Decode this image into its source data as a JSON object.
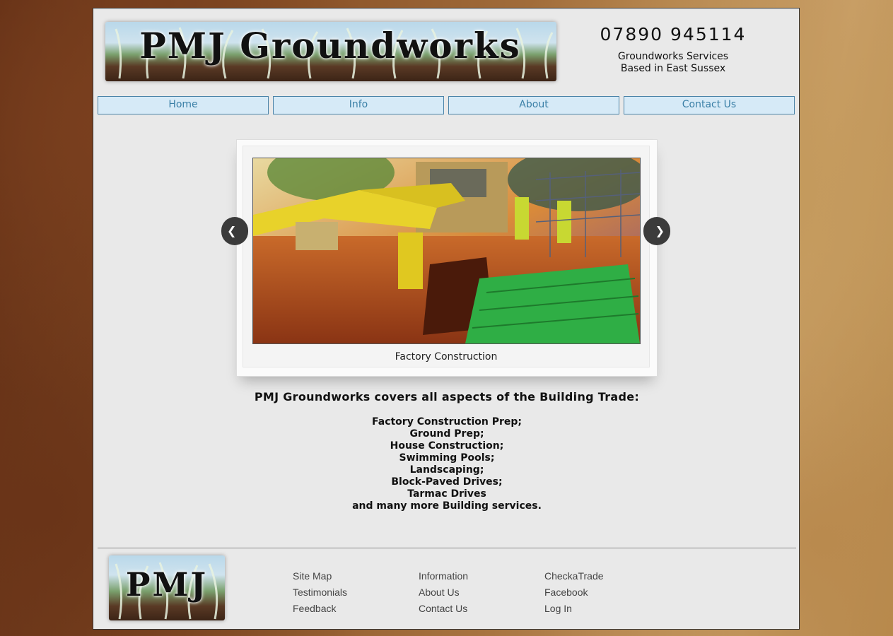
{
  "header": {
    "logo_text": "PMJ Groundworks",
    "phone": "07890 945114",
    "tagline_line1": "Groundworks Services",
    "tagline_line2": "Based in East Sussex"
  },
  "nav": {
    "items": [
      {
        "label": "Home"
      },
      {
        "label": "Info"
      },
      {
        "label": "About"
      },
      {
        "label": "Contact Us"
      }
    ]
  },
  "slider": {
    "caption": "Factory Construction",
    "prev_icon": "chevron-left-icon",
    "next_icon": "chevron-right-icon"
  },
  "content": {
    "intro": "PMJ Groundworks covers all aspects of the Building Trade:",
    "services": [
      "Factory Construction Prep;",
      "Ground Prep;",
      "House Construction;",
      "Swimming Pools;",
      "Landscaping;",
      "Block-Paved Drives;",
      "Tarmac Drives",
      "and many more Building services."
    ]
  },
  "footer": {
    "logo_text": "PMJ",
    "columns": [
      [
        "Site Map",
        "Testimonials",
        "Feedback"
      ],
      [
        "Information",
        "About Us",
        "Contact Us"
      ],
      [
        "CheckaTrade",
        "Facebook",
        "Log In"
      ]
    ]
  },
  "colors": {
    "nav_bg": "#d6eaf7",
    "nav_border": "#4a83a8",
    "nav_text": "#3a7fa6",
    "page_bg": "#e9e9e9"
  }
}
